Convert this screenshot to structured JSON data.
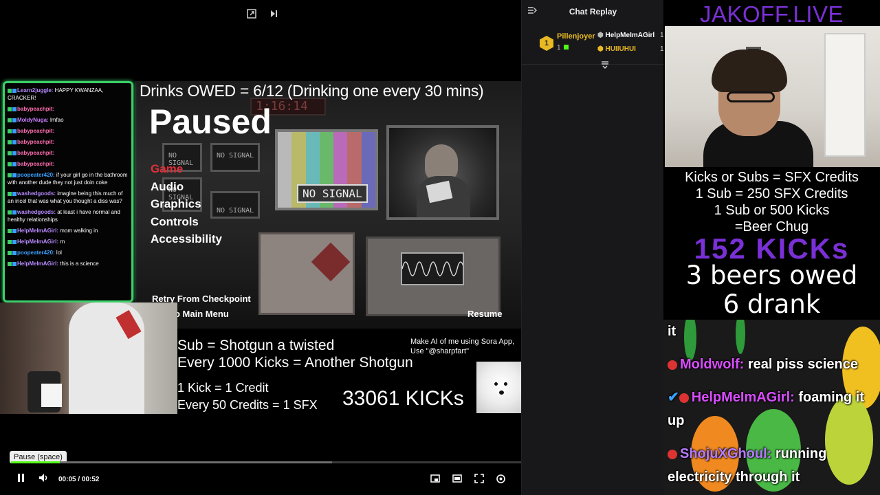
{
  "top_controls": {
    "popout_icon": "popout-icon",
    "next_icon": "skip-next-icon"
  },
  "overlay": {
    "drinks_owed": "Drinks OWED =  6/12 (Drinking one every 30 mins)",
    "promo_line1": "Sub = Shotgun a twisted",
    "promo_line2": "Every 1000 Kicks = Another Shotgun",
    "promo_line3": "1 Kick = 1 Credit",
    "promo_line4": "Every 50 Credits  = 1 SFX",
    "kicks_count": "33061 KICKs",
    "sora_line1": "Make AI of me using Sora App,",
    "sora_line2": "Use \"@sharpfart\""
  },
  "game": {
    "paused_title": "Paused",
    "menu": [
      "Game",
      "Audio",
      "Graphics",
      "Controls",
      "Accessibility"
    ],
    "active_menu_index": 0,
    "retry_label": "Retry From Checkpoint",
    "main_menu_label": "o Main Menu",
    "resume_label": "Resume",
    "no_signal": "NO SIGNAL",
    "small_no_signal": "NO SIGNAL",
    "clock": "1:16:14"
  },
  "overlay_chat": [
    {
      "user": "Learn2juggle",
      "text": " HAPPY KWANZAA, CRACKER!",
      "color": "#b88bff"
    },
    {
      "user": "babypeachpit",
      "text": " ",
      "color": "#ff6fb0"
    },
    {
      "user": "MoldyNuga",
      "text": " lmfao",
      "color": "#c87dff"
    },
    {
      "user": "babypeachpit",
      "text": " ",
      "color": "#ff6fb0"
    },
    {
      "user": "babypeachpit",
      "text": " ",
      "color": "#ff6fb0"
    },
    {
      "user": "babypeachpit",
      "text": " ",
      "color": "#ff6fb0"
    },
    {
      "user": "babypeachpit",
      "text": " ",
      "color": "#ff6fb0"
    },
    {
      "user": "poopeater420",
      "text": " if your girl go in the bathroom with another dude they not just doin coke",
      "color": "#3aa0ff"
    },
    {
      "user": "washedgoods",
      "text": " imagine being this much of an incel that was what you thought a diss was?",
      "color": "#b88bff"
    },
    {
      "user": "washedgoods",
      "text": " at least i have normal and healthy relationships",
      "color": "#b88bff"
    },
    {
      "user": "HelpMeImAGirl",
      "text": " mom walking in",
      "color": "#b88bff"
    },
    {
      "user": "HelpMeImAGirl",
      "text": " rn",
      "color": "#b88bff"
    },
    {
      "user": "poopeater420",
      "text": " lol",
      "color": "#3aa0ff"
    },
    {
      "user": "HelpMeImAGirl",
      "text": " this is a science",
      "color": "#b88bff"
    }
  ],
  "player": {
    "tooltip": "Pause (space)",
    "time": "00:05 / 00:52",
    "progress_fraction": 0.096,
    "buffer_fraction": 0.63,
    "accent": "#53fc18"
  },
  "chat_replay": {
    "title": "Chat Replay",
    "top_gifter": "Pillenjoyer",
    "top_gifter_rank": "1",
    "top_gifter_count": "1",
    "entries": [
      {
        "name": "HelpMeImAGirl",
        "num": "1",
        "color": "#ffffff"
      },
      {
        "name": "HUIIUHUI",
        "num": "1",
        "color": "#e8b923"
      }
    ]
  },
  "right": {
    "brand": "JAKOFF.LIVE",
    "credits_lines": [
      "Kicks or Subs = SFX Credits",
      "1 Sub = 250 SFX Credits",
      "1 Sub or 500 Kicks",
      "=Beer Chug"
    ],
    "kicks_big": "152 KICKs",
    "beers_owed": "3 beers owed",
    "drank": "6 drank",
    "chat_partial": "it",
    "chat": [
      {
        "user": "Moldwolf:",
        "text": " real piss science",
        "color": "#d94dff"
      },
      {
        "user": "HelpMeImAGirl:",
        "text": " foaming it",
        "color": "#d94dff"
      },
      {
        "user": "",
        "text": "up",
        "color": "#ffffff"
      },
      {
        "user": "ShojuXGhoul:",
        "text": " running",
        "color": "#b57bff"
      },
      {
        "user": "",
        "text": "electricity through it",
        "color": "#ffffff"
      }
    ]
  }
}
